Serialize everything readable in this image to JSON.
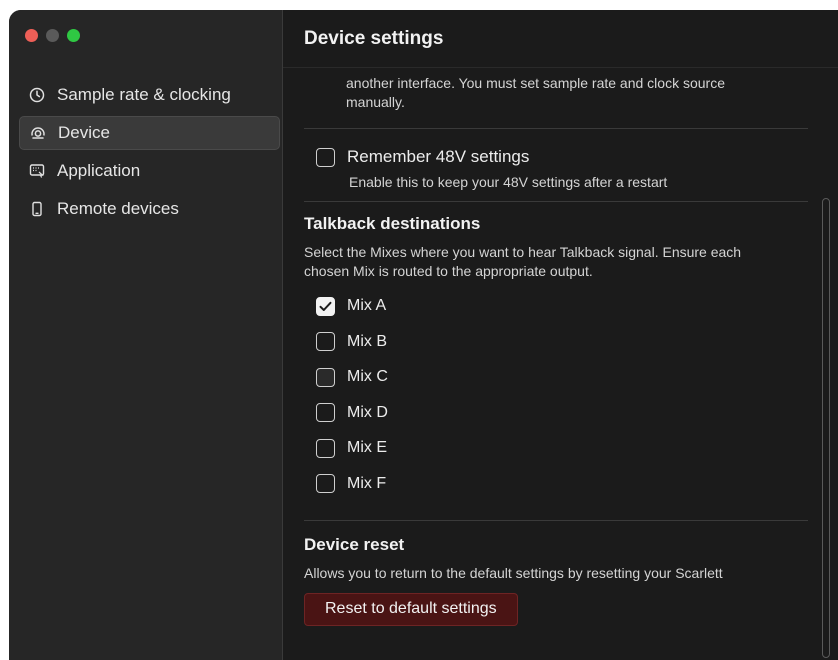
{
  "window": {
    "traffic_lights": {
      "close": "#ee5f57",
      "minimize": "#5a5a5a",
      "zoom": "#2fc843"
    }
  },
  "sidebar": {
    "items": [
      {
        "label": "Sample rate & clocking",
        "icon": "clock-icon",
        "active": false
      },
      {
        "label": "Device",
        "icon": "device-icon",
        "active": true
      },
      {
        "label": "Application",
        "icon": "application-icon",
        "active": false
      },
      {
        "label": "Remote devices",
        "icon": "phone-icon",
        "active": false
      }
    ]
  },
  "header": {
    "title": "Device settings"
  },
  "clocking_note": {
    "line1": "another interface. You must set sample rate and clock source",
    "line2": "manually."
  },
  "remember_48v": {
    "label": "Remember 48V settings",
    "description": "Enable this to keep your 48V settings after a restart",
    "checked": false
  },
  "talkback": {
    "title": "Talkback destinations",
    "description_line1": "Select the Mixes where you want to hear Talkback signal. Ensure each",
    "description_line2": "chosen Mix is routed to the appropriate output.",
    "mixes": [
      {
        "label": "Mix A",
        "checked": true
      },
      {
        "label": "Mix B",
        "checked": false
      },
      {
        "label": "Mix C",
        "checked": false
      },
      {
        "label": "Mix D",
        "checked": false
      },
      {
        "label": "Mix E",
        "checked": false
      },
      {
        "label": "Mix F",
        "checked": false
      }
    ]
  },
  "device_reset": {
    "title": "Device reset",
    "description": "Allows you to return to the default settings by resetting your Scarlett",
    "button_label": "Reset to default settings"
  },
  "colors": {
    "background": "#1b1b1b",
    "sidebar": "#262626",
    "reset_button": "#4a1414"
  }
}
